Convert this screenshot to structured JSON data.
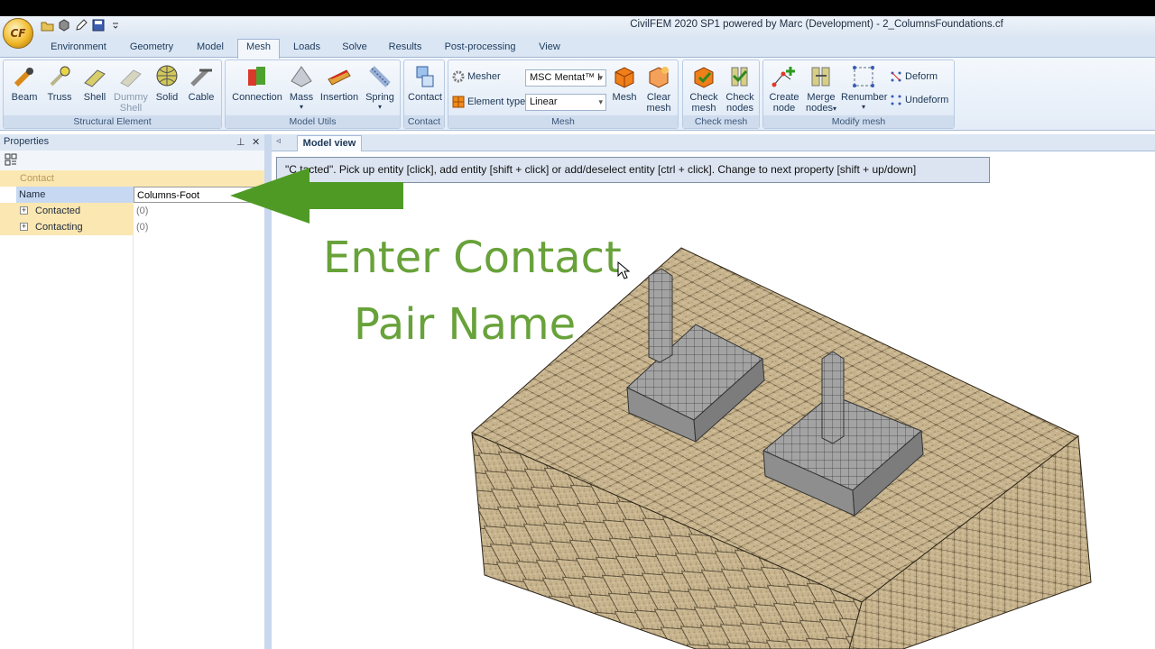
{
  "window": {
    "title": "CivilFEM 2020 SP1 powered by Marc (Development) - 2_ColumnsFoundations.cf",
    "app_logo": "CF"
  },
  "quick_access": [
    "open-folder-icon",
    "cube-icon",
    "edit-icon",
    "save-icon"
  ],
  "menu_tabs": [
    "Environment",
    "Geometry",
    "Model",
    "Mesh",
    "Loads",
    "Solve",
    "Results",
    "Post-processing",
    "View"
  ],
  "active_tab": "Mesh",
  "ribbon": {
    "structural": {
      "label": "Structural Element",
      "beam": "Beam",
      "truss": "Truss",
      "shell": "Shell",
      "dummy1": "Dummy",
      "dummy2": "Shell",
      "solid": "Solid",
      "cable": "Cable"
    },
    "model_utils": {
      "label": "Model Utils",
      "connection": "Connection",
      "mass": "Mass",
      "insertion": "Insertion",
      "spring": "Spring"
    },
    "contact": {
      "label": "Contact",
      "contact": "Contact"
    },
    "mesh": {
      "label": "Mesh",
      "mesher_label": "Mesher",
      "mesher_value": "MSC Mentat™ I",
      "element_type_label": "Element type",
      "element_type_value": "Linear",
      "mesh": "Mesh",
      "clear1": "Clear",
      "clear2": "mesh"
    },
    "check_mesh": {
      "label": "Check mesh",
      "check_mesh1": "Check",
      "check_mesh2": "mesh",
      "check_nodes1": "Check",
      "check_nodes2": "nodes"
    },
    "modify_mesh": {
      "label": "Modify mesh",
      "create1": "Create",
      "create2": "node",
      "merge1": "Merge",
      "merge2": "nodes",
      "renumber": "Renumber",
      "deform": "Deform",
      "undeform": "Undeform"
    }
  },
  "properties": {
    "title": "Properties",
    "pin_glyph": "⊥",
    "close_glyph": "✕",
    "category": "Contact",
    "rows": [
      {
        "name": "Name",
        "value": "Columns-Foot"
      },
      {
        "name": "Contacted",
        "value": "(0)"
      },
      {
        "name": "Contacting",
        "value": "(0)"
      }
    ]
  },
  "view": {
    "tab": "Model view",
    "hint": "\"C  tacted\". Pick up entity [click], add entity [shift + click] or add/deselect entity [ctrl + click]. Change to next property [shift + up/down]"
  },
  "overlay": {
    "line1": "Enter Contact",
    "line2": "Pair Name",
    "color": "#68a23a"
  },
  "colors": {
    "mesh_fill": "#c8b58f",
    "column_fill": "#9a9a9a",
    "arrow": "#4f9a24"
  }
}
